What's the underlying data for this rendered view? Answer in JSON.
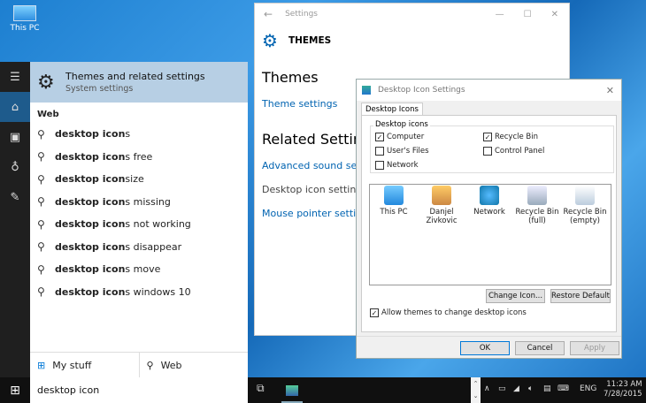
{
  "desktop": {
    "icon_label": "This PC"
  },
  "sidebar": {
    "icons": [
      "hamburger-icon",
      "home-icon",
      "notebook-icon",
      "lightbulb-icon",
      "feedback-icon"
    ]
  },
  "search": {
    "best_match": {
      "title": "Themes and related settings",
      "subtitle": "System settings"
    },
    "web_header": "Web",
    "suggestions": [
      {
        "bold": "desktop icon",
        "rest": "s"
      },
      {
        "bold": "desktop icon",
        "rest": "s free"
      },
      {
        "bold": "desktop icon",
        "rest": " size"
      },
      {
        "bold": "desktop icon",
        "rest": "s missing"
      },
      {
        "bold": "desktop icon",
        "rest": "s not working"
      },
      {
        "bold": "desktop icon",
        "rest": "s disappear"
      },
      {
        "bold": "desktop icon",
        "rest": "s move"
      },
      {
        "bold": "desktop icon",
        "rest": "s windows 10"
      }
    ],
    "my_stuff": "My stuff",
    "web": "Web",
    "query": "desktop icon"
  },
  "settings": {
    "window_title": "Settings",
    "header": "THEMES",
    "section1": "Themes",
    "link1": "Theme settings",
    "section2": "Related Settings",
    "link2": "Advanced sound settings",
    "item3": "Desktop icon settings",
    "link4": "Mouse pointer settings"
  },
  "dialog": {
    "title": "Desktop Icon Settings",
    "tab": "Desktop Icons",
    "group": "Desktop icons",
    "checkboxes": [
      {
        "label": "Computer",
        "checked": true
      },
      {
        "label": "Recycle Bin",
        "checked": true
      },
      {
        "label": "User's Files",
        "checked": false
      },
      {
        "label": "Control Panel",
        "checked": false
      },
      {
        "label": "Network",
        "checked": false
      }
    ],
    "icons": [
      {
        "label": "This PC"
      },
      {
        "label": "Danjel Zivkovic"
      },
      {
        "label": "Network"
      },
      {
        "label": "Recycle Bin (full)"
      },
      {
        "label": "Recycle Bin (empty)"
      }
    ],
    "change_icon": "Change Icon...",
    "restore": "Restore Default",
    "allow_themes": "Allow themes to change desktop icons",
    "allow_checked": true,
    "ok": "OK",
    "cancel": "Cancel",
    "apply": "Apply"
  },
  "taskbar": {
    "lang": "ENG",
    "time": "11:23 AM",
    "date": "7/28/2015"
  }
}
